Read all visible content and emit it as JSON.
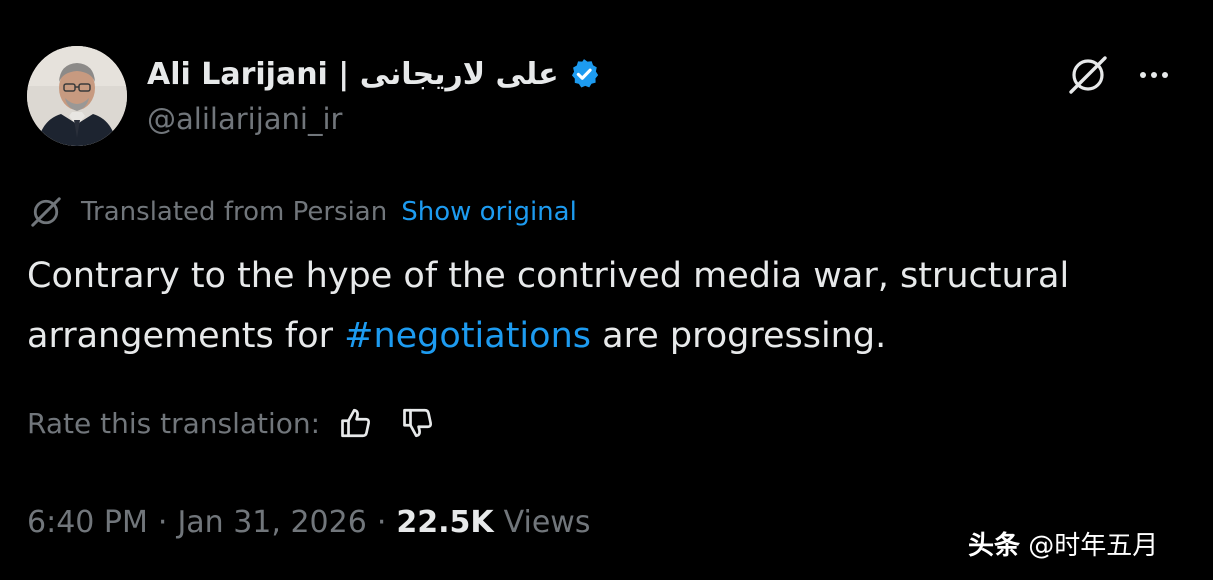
{
  "author": {
    "display_name": "Ali Larijani | علی لاریجانی",
    "handle": "@alilarijani_ir",
    "verified": true,
    "verified_color": "#1d9bf0"
  },
  "header_actions": {
    "grok_icon": "grok-icon",
    "more_icon": "more-icon"
  },
  "translation": {
    "icon": "grok-icon",
    "label": "Translated from Persian",
    "show_original": "Show original"
  },
  "tweet": {
    "text_before": "Contrary to the hype of the contrived media war, structural arrangements for ",
    "hashtag": "#negotiations",
    "text_after": " are progressing."
  },
  "rating": {
    "label": "Rate this translation:",
    "thumb_up_icon": "thumbs-up-icon",
    "thumb_down_icon": "thumbs-down-icon"
  },
  "meta": {
    "time": "6:40 PM",
    "separator": "·",
    "date": "Jan 31, 2026",
    "views_count": "22.5K",
    "views_label": "Views"
  },
  "watermark": {
    "brand": "头条",
    "account": "@时年五月"
  },
  "colors": {
    "background": "#000000",
    "text_primary": "#e7e9ea",
    "text_secondary": "#71767b",
    "accent": "#1d9bf0"
  }
}
